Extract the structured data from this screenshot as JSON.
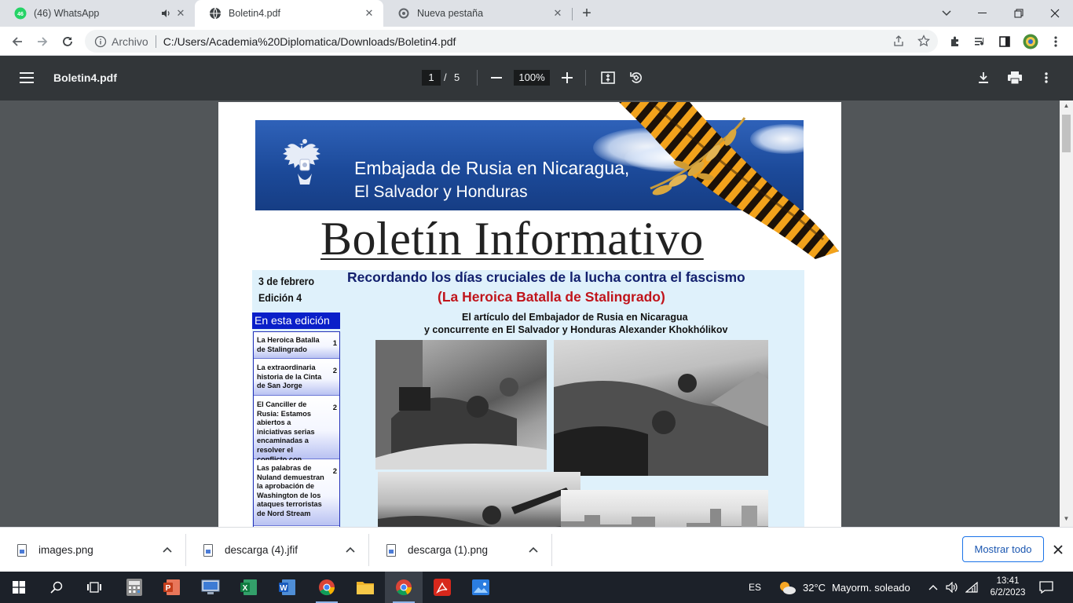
{
  "browser": {
    "tabs": [
      {
        "title": "(46) WhatsApp",
        "badge": "46",
        "active": false,
        "muted_icon": "speaker-icon"
      },
      {
        "title": "Boletin4.pdf",
        "active": true
      },
      {
        "title": "Nueva pestaña",
        "active": false
      }
    ],
    "omnibox": {
      "scheme_label": "Archivo",
      "url": "C:/Users/Academia%20Diplomatica/Downloads/Boletin4.pdf"
    }
  },
  "pdf_viewer": {
    "filename": "Boletin4.pdf",
    "current_page": "1",
    "page_separator": "/",
    "total_pages": "5",
    "zoom": "100%"
  },
  "document": {
    "banner_line1": "Embajada de Rusia en Nicaragua,",
    "banner_line2": "El Salvador y Honduras",
    "title": "Boletín Informativo",
    "date": "3 de febrero",
    "edition": "Edición  4",
    "toc_heading": "En esta edición",
    "toc": [
      {
        "title": "La Heroica Batalla de Stalingrado",
        "page": "1"
      },
      {
        "title": "La extraordinaria historia de la Cinta de San Jorge",
        "page": "2"
      },
      {
        "title": "El Canciller de Rusia: Estamos abiertos a iniciativas serias encaminadas a resolver el conflicto con Ucrania",
        "page": "2"
      },
      {
        "title": "Las palabras de Nuland demuestran la aprobación de Washington de los ataques terroristas de Nord Stream",
        "page": "2"
      }
    ],
    "headline": "Recordando los días cruciales de la lucha contra el fascismo",
    "subheadline": "(La Heroica Batalla de Stalingrado)",
    "byline_line1": "El artículo del Embajador de Rusia en Nicaragua",
    "byline_line2": "y concurrente en El Salvador y Honduras Alexander Khokhólikov",
    "colors": {
      "banner_blue": "#1c4a9a",
      "headline_navy": "#13206e",
      "headline_red": "#c0141b",
      "toc_blue": "#0a1fc9"
    }
  },
  "downloads": {
    "items": [
      {
        "name": "images.png"
      },
      {
        "name": "descarga (4).jfif"
      },
      {
        "name": "descarga (1).png"
      }
    ],
    "show_all_label": "Mostrar todo"
  },
  "taskbar": {
    "language": "ES",
    "weather_temp": "32°C",
    "weather_desc": "Mayorm. soleado",
    "time": "13:41",
    "date": "6/2/2023"
  }
}
